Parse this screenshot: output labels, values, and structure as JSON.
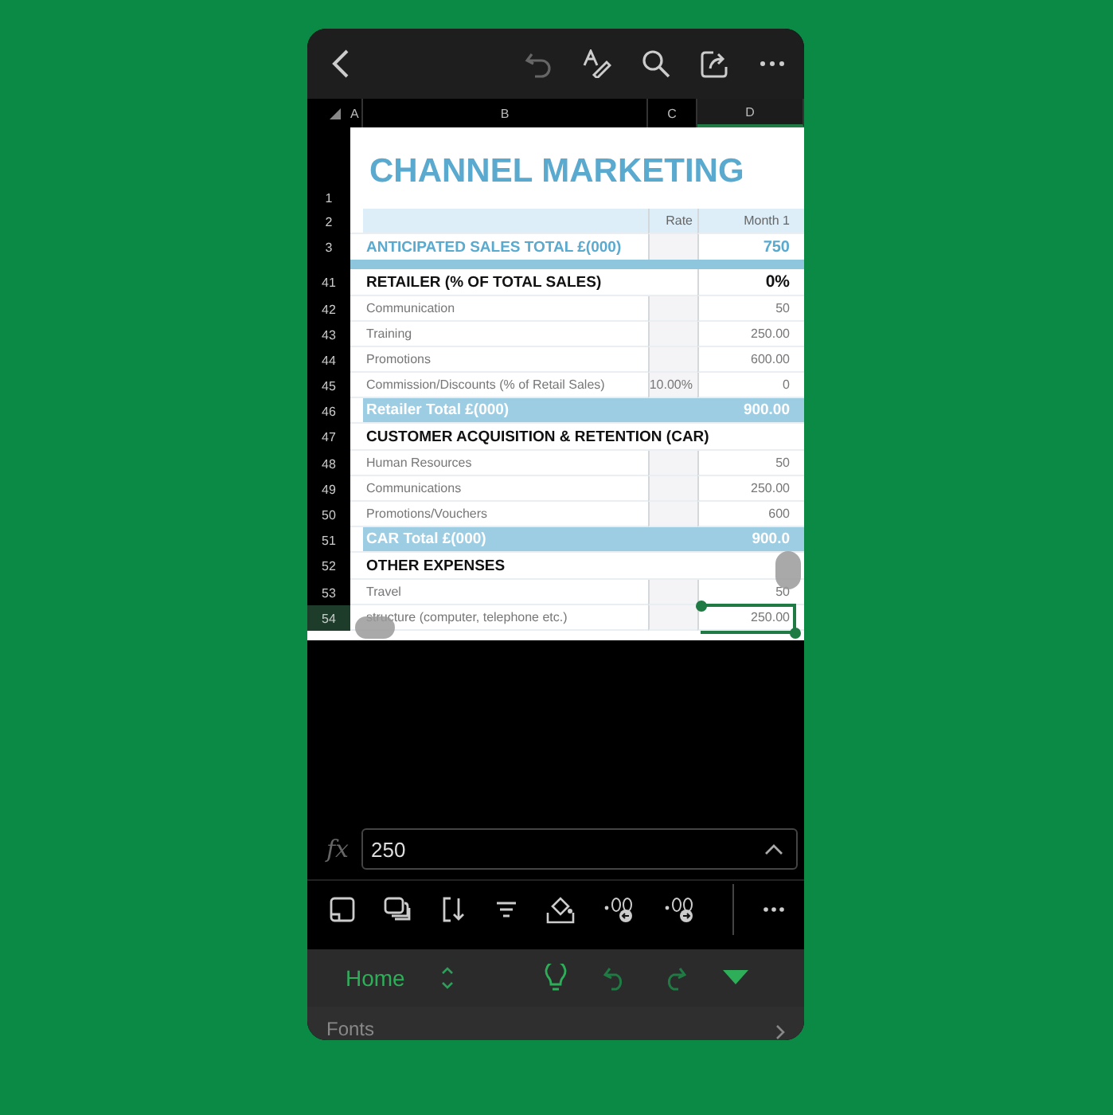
{
  "sheet": {
    "columns": [
      {
        "label": "A",
        "selected": false
      },
      {
        "label": "B",
        "selected": false
      },
      {
        "label": "C",
        "selected": false
      },
      {
        "label": "D",
        "selected": true
      }
    ],
    "title": {
      "number": "1",
      "text": "CHANNEL MARKETING"
    },
    "rows": [
      {
        "number": "2",
        "kind": "header",
        "rate": "Rate",
        "value": "Month 1",
        "selected": false
      },
      {
        "number": "3",
        "kind": "anticipated",
        "label": "ANTICIPATED SALES TOTAL £(000)",
        "value": "750",
        "selected": false
      },
      {
        "kind": "strip",
        "selected": false
      },
      {
        "number": "41",
        "kind": "section",
        "label": "RETAILER (% OF TOTAL SALES)",
        "value": "0%",
        "selected": false
      },
      {
        "number": "42",
        "kind": "item",
        "label": "Communication",
        "value": "50",
        "selected": false
      },
      {
        "number": "43",
        "kind": "item",
        "label": "Training",
        "value": "250.00",
        "selected": false
      },
      {
        "number": "44",
        "kind": "item",
        "label": "Promotions",
        "value": "600.00",
        "selected": false
      },
      {
        "number": "45",
        "kind": "item",
        "label": "Commission/Discounts (% of Retail Sales)",
        "rate": "10.00%",
        "value": "0",
        "selected": false
      },
      {
        "number": "46",
        "kind": "total",
        "label": "Retailer Total £(000)",
        "value": "900.00",
        "selected": false
      },
      {
        "number": "47",
        "kind": "section",
        "label": "CUSTOMER ACQUISITION & RETENTION (CAR)",
        "selected": false
      },
      {
        "number": "48",
        "kind": "item",
        "label": "Human Resources",
        "value": "50",
        "selected": false
      },
      {
        "number": "49",
        "kind": "item",
        "label": "Communications",
        "value": "250.00",
        "selected": false
      },
      {
        "number": "50",
        "kind": "item",
        "label": "Promotions/Vouchers",
        "value": "600",
        "selected": false
      },
      {
        "number": "51",
        "kind": "total",
        "label": "CAR Total £(000)",
        "value": "900.0",
        "selected": false
      },
      {
        "number": "52",
        "kind": "section",
        "label": "OTHER EXPENSES",
        "selected": false
      },
      {
        "number": "53",
        "kind": "item",
        "label": "Travel",
        "value": "50",
        "selected": false
      },
      {
        "number": "54",
        "kind": "item",
        "label": "structure (computer, telephone etc.)",
        "value": "250.00",
        "selected": true
      }
    ]
  },
  "formula_bar": {
    "function_label": "fx",
    "value": "250"
  },
  "ribbon": {
    "tab": "Home"
  },
  "panel": {
    "label": "Fonts"
  }
}
